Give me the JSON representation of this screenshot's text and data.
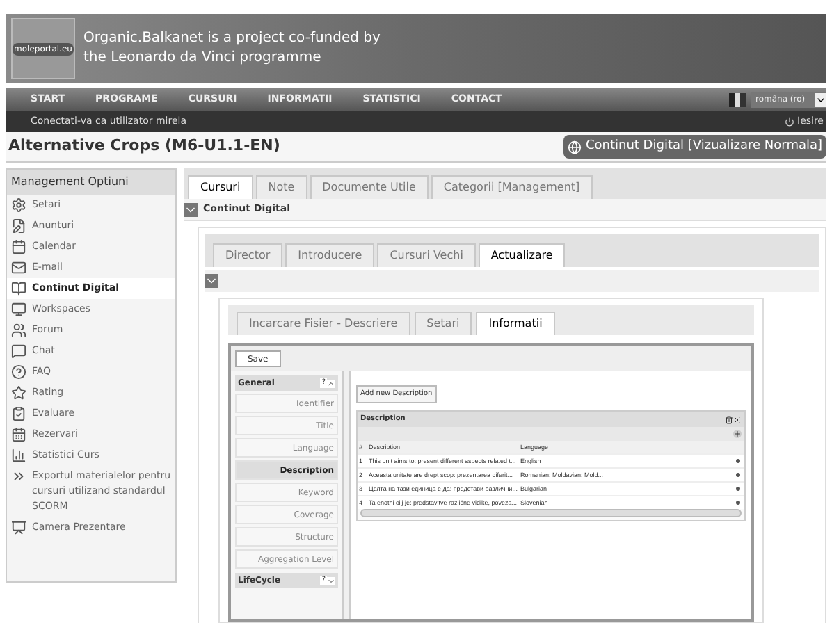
{
  "banner": {
    "logo_text": "moleportal.eu",
    "line_1": "Organic.Balkanet is a project co-funded by",
    "line_2": "the Leonardo da Vinci programme"
  },
  "nav": {
    "items": [
      "START",
      "PROGRAME",
      "CURSURI",
      "INFORMATII",
      "STATISTICI",
      "CONTACT"
    ],
    "language": "româna (ro)"
  },
  "user_bar": {
    "login_text": "Conectati-va ca utilizator mirela",
    "logout": "Iesire"
  },
  "page": {
    "title": "Alternative Crops (M6-U1.1-EN)",
    "view_button": "Continut Digital [Vizualizare Normala]"
  },
  "sidebar": {
    "title": "Management Optiuni",
    "items": [
      {
        "label": "Setari",
        "selected": false
      },
      {
        "label": "Anunturi",
        "selected": false
      },
      {
        "label": "Calendar",
        "selected": false
      },
      {
        "label": "E-mail",
        "selected": false
      },
      {
        "label": "Continut Digital",
        "selected": true
      },
      {
        "label": "Workspaces",
        "selected": false
      },
      {
        "label": "Forum",
        "selected": false
      },
      {
        "label": "Chat",
        "selected": false
      },
      {
        "label": "FAQ",
        "selected": false
      },
      {
        "label": "Rating",
        "selected": false
      },
      {
        "label": "Evaluare",
        "selected": false
      },
      {
        "label": "Rezervari",
        "selected": false
      },
      {
        "label": "Statistici Curs",
        "selected": false
      },
      {
        "label": "Exportul materialelor pentru cursuri utilizand standardul SCORM",
        "selected": false
      },
      {
        "label": "Camera Prezentare",
        "selected": false
      }
    ]
  },
  "main_tabs": [
    {
      "label": "Cursuri",
      "selected": true
    },
    {
      "label": "Note",
      "selected": false
    },
    {
      "label": "Documente Utile",
      "selected": false
    },
    {
      "label": "Categorii [Management]",
      "selected": false
    }
  ],
  "section_title": "Continut Digital",
  "content_tabs": [
    {
      "label": "Director",
      "selected": false
    },
    {
      "label": "Introducere",
      "selected": false
    },
    {
      "label": "Cursuri Vechi",
      "selected": false
    },
    {
      "label": "Actualizare",
      "selected": true
    }
  ],
  "file_tabs": [
    {
      "label": "Incarcare Fisier - Descriere",
      "selected": false
    },
    {
      "label": "Setari",
      "selected": false
    },
    {
      "label": "Informatii",
      "selected": true
    }
  ],
  "editor": {
    "save": "Save",
    "groups": [
      {
        "title": "General",
        "help": "?",
        "expanded": true,
        "fields": [
          {
            "label": "Identifier",
            "selected": false
          },
          {
            "label": "Title",
            "selected": false
          },
          {
            "label": "Language",
            "selected": false
          },
          {
            "label": "Description",
            "selected": true
          },
          {
            "label": "Keyword",
            "selected": false
          },
          {
            "label": "Coverage",
            "selected": false
          },
          {
            "label": "Structure",
            "selected": false
          },
          {
            "label": "Aggregation Level",
            "selected": false
          }
        ]
      },
      {
        "title": "LifeCycle",
        "help": "?",
        "expanded": false
      }
    ],
    "add_button": "Add new Description",
    "grid": {
      "title": "Description",
      "columns": [
        "#",
        "Description",
        "Language"
      ],
      "rows": [
        [
          "1",
          "This unit aims to: present different aspects related t...",
          "English"
        ],
        [
          "2",
          "Aceasta unitate are drept scop: prezentarea diferit...",
          "Romanian; Moldavian; Mold..."
        ],
        [
          "3",
          "Целта на тази единица е да: представи различни...",
          "Bulgarian"
        ],
        [
          "4",
          "Ta enotni cilj je: predstavitve različne vidike, poveza...",
          "Slovenian"
        ]
      ]
    }
  }
}
